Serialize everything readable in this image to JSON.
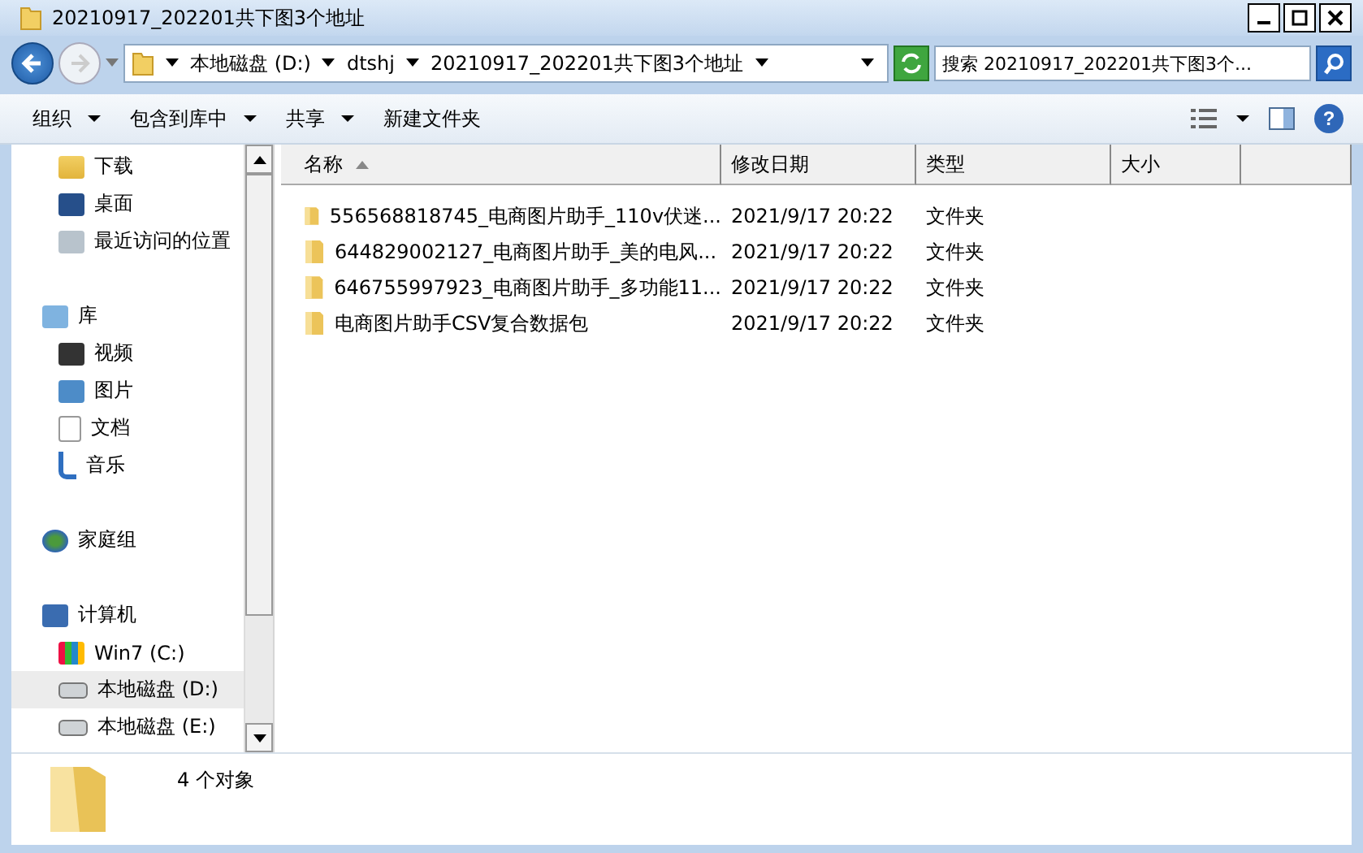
{
  "window": {
    "title": "20210917_202201共下图3个地址"
  },
  "address": {
    "crumbs": [
      "本地磁盘 (D:)",
      "dtshj",
      "20210917_202201共下图3个地址"
    ]
  },
  "search": {
    "placeholder": "搜索 20210917_202201共下图3个..."
  },
  "toolbar": [
    {
      "label": "组织",
      "has_menu": true
    },
    {
      "label": "包含到库中",
      "has_menu": true
    },
    {
      "label": "共享",
      "has_menu": true
    },
    {
      "label": "新建文件夹",
      "has_menu": false
    }
  ],
  "sidebar": {
    "groups": [
      {
        "items": [
          {
            "label": "下载",
            "selected": false
          },
          {
            "label": "桌面",
            "selected": false
          },
          {
            "label": "最近访问的位置",
            "selected": false
          }
        ]
      },
      {
        "label": "库",
        "selected": false,
        "children": [
          {
            "label": "视频",
            "selected": false
          },
          {
            "label": "图片",
            "selected": false
          },
          {
            "label": "文档",
            "selected": false
          },
          {
            "label": "音乐",
            "selected": false
          }
        ]
      },
      {
        "label": "家庭组",
        "selected": false
      },
      {
        "label": "计算机",
        "selected": false,
        "children": [
          {
            "label": "Win7 (C:)",
            "selected": false
          },
          {
            "label": "本地磁盘 (D:)",
            "selected": true
          },
          {
            "label": "本地磁盘 (E:)",
            "selected": false
          }
        ]
      }
    ]
  },
  "table": {
    "columns": [
      {
        "label": "名称",
        "sorted": true
      },
      {
        "label": "修改日期",
        "sorted": false
      },
      {
        "label": "类型",
        "sorted": false
      },
      {
        "label": "大小",
        "sorted": false
      }
    ],
    "rows": [
      {
        "name": "556568818745_电商图片助手_110v伏迷...",
        "date": "2021/9/17 20:22",
        "type": "文件夹"
      },
      {
        "name": "644829002127_电商图片助手_美的电风...",
        "date": "2021/9/17 20:22",
        "type": "文件夹"
      },
      {
        "name": "646755997923_电商图片助手_多功能11...",
        "date": "2021/9/17 20:22",
        "type": "文件夹"
      },
      {
        "name": "电商图片助手CSV复合数据包",
        "date": "2021/9/17 20:22",
        "type": "文件夹"
      }
    ]
  },
  "help": {
    "label": "?"
  },
  "status_bar": {
    "count": "4 个对象"
  }
}
